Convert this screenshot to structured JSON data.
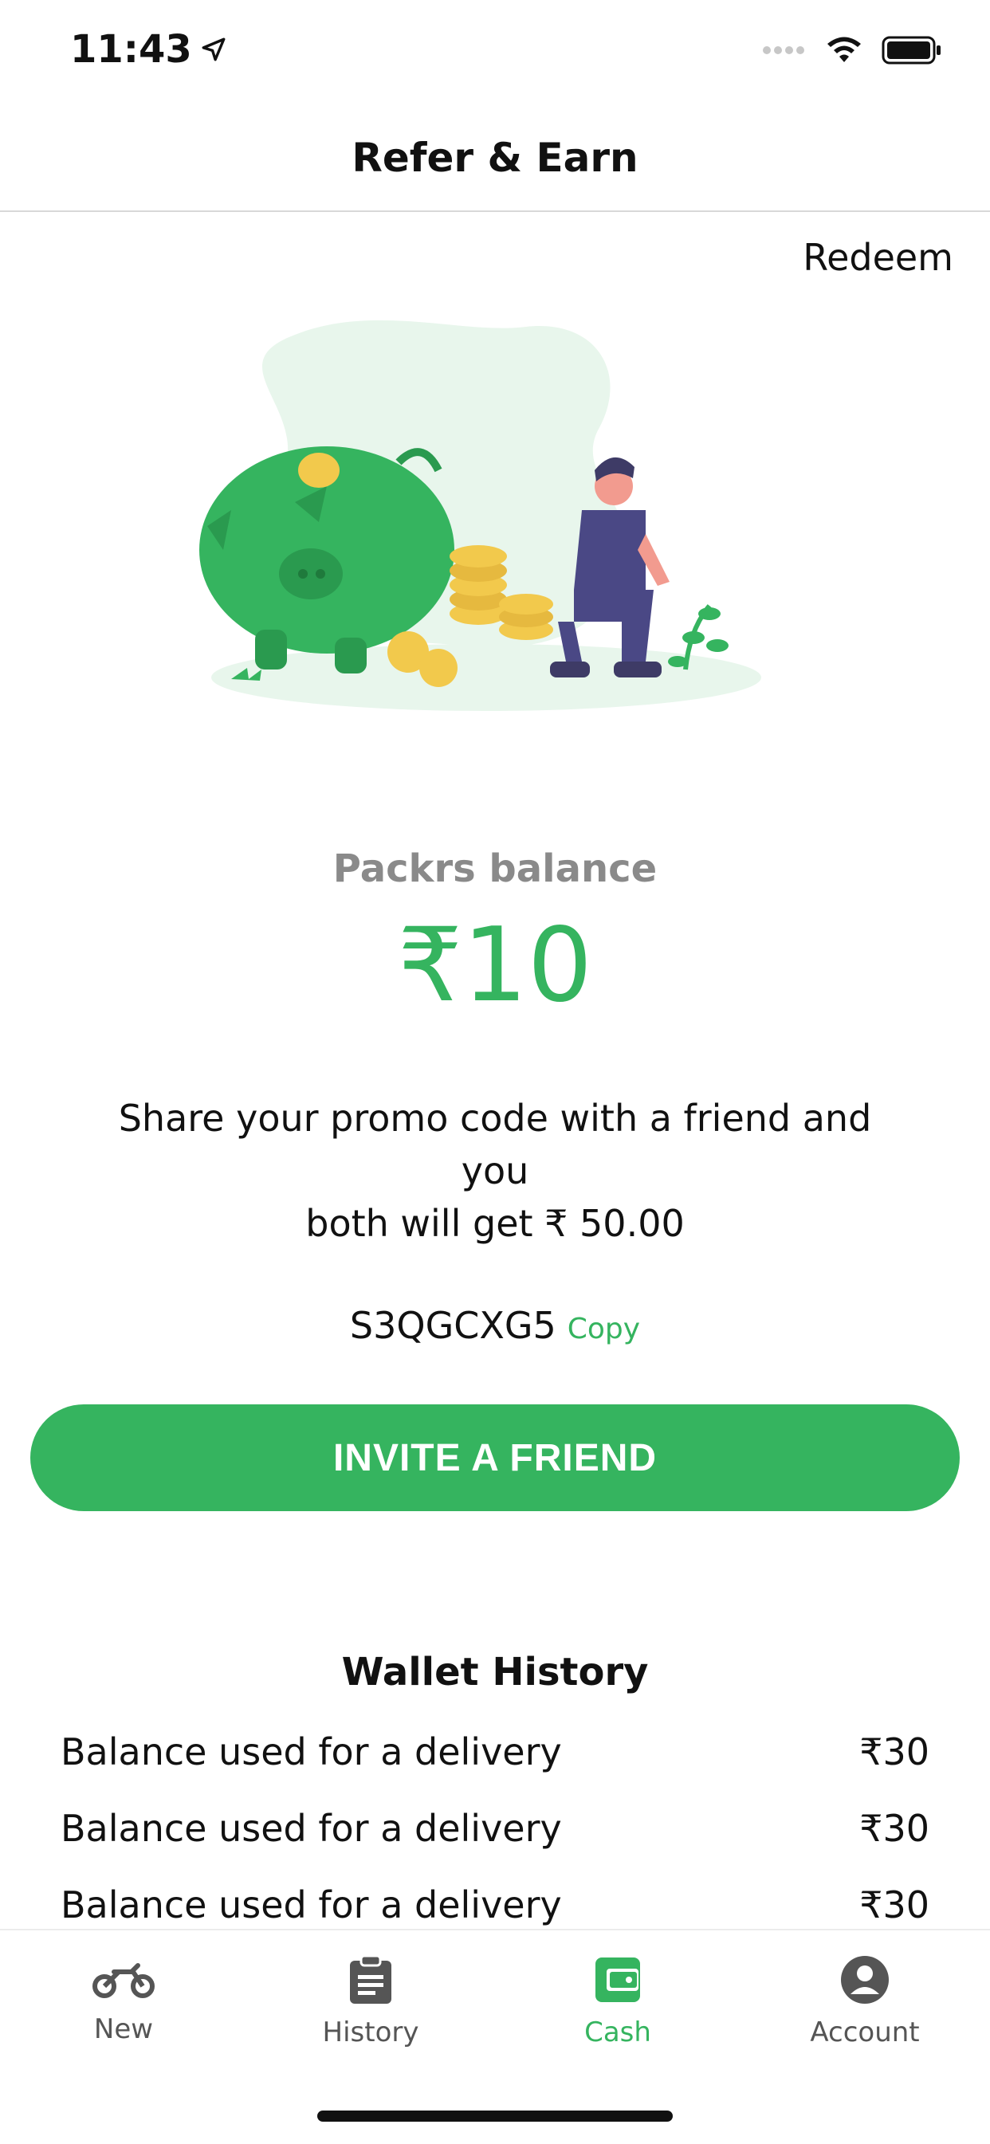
{
  "status_bar": {
    "time": "11:43"
  },
  "header": {
    "title": "Refer & Earn"
  },
  "redeem_label": "Redeem",
  "balance": {
    "label": "Packrs balance",
    "amount": "₹10"
  },
  "share": {
    "text_line1": "Share your promo code with a friend and you",
    "text_line2": "both will get ₹ 50.00"
  },
  "promo": {
    "code": "S3QGCXG5",
    "copy_label": "Copy"
  },
  "invite_button_label": "INVITE A FRIEND",
  "wallet_history": {
    "title": "Wallet History",
    "items": [
      {
        "description": "Balance used for a delivery",
        "amount": "₹30"
      },
      {
        "description": "Balance used for a delivery",
        "amount": "₹30"
      },
      {
        "description": "Balance used for a delivery",
        "amount": "₹30"
      }
    ]
  },
  "tab_bar": {
    "tabs": [
      {
        "label": "New",
        "icon": "bike-icon",
        "active": false
      },
      {
        "label": "History",
        "icon": "clipboard-icon",
        "active": false
      },
      {
        "label": "Cash",
        "icon": "wallet-icon",
        "active": true
      },
      {
        "label": "Account",
        "icon": "account-icon",
        "active": false
      }
    ]
  },
  "colors": {
    "accent": "#35b45f",
    "muted_text": "#8a8a8a",
    "tab_inactive": "#555555"
  }
}
